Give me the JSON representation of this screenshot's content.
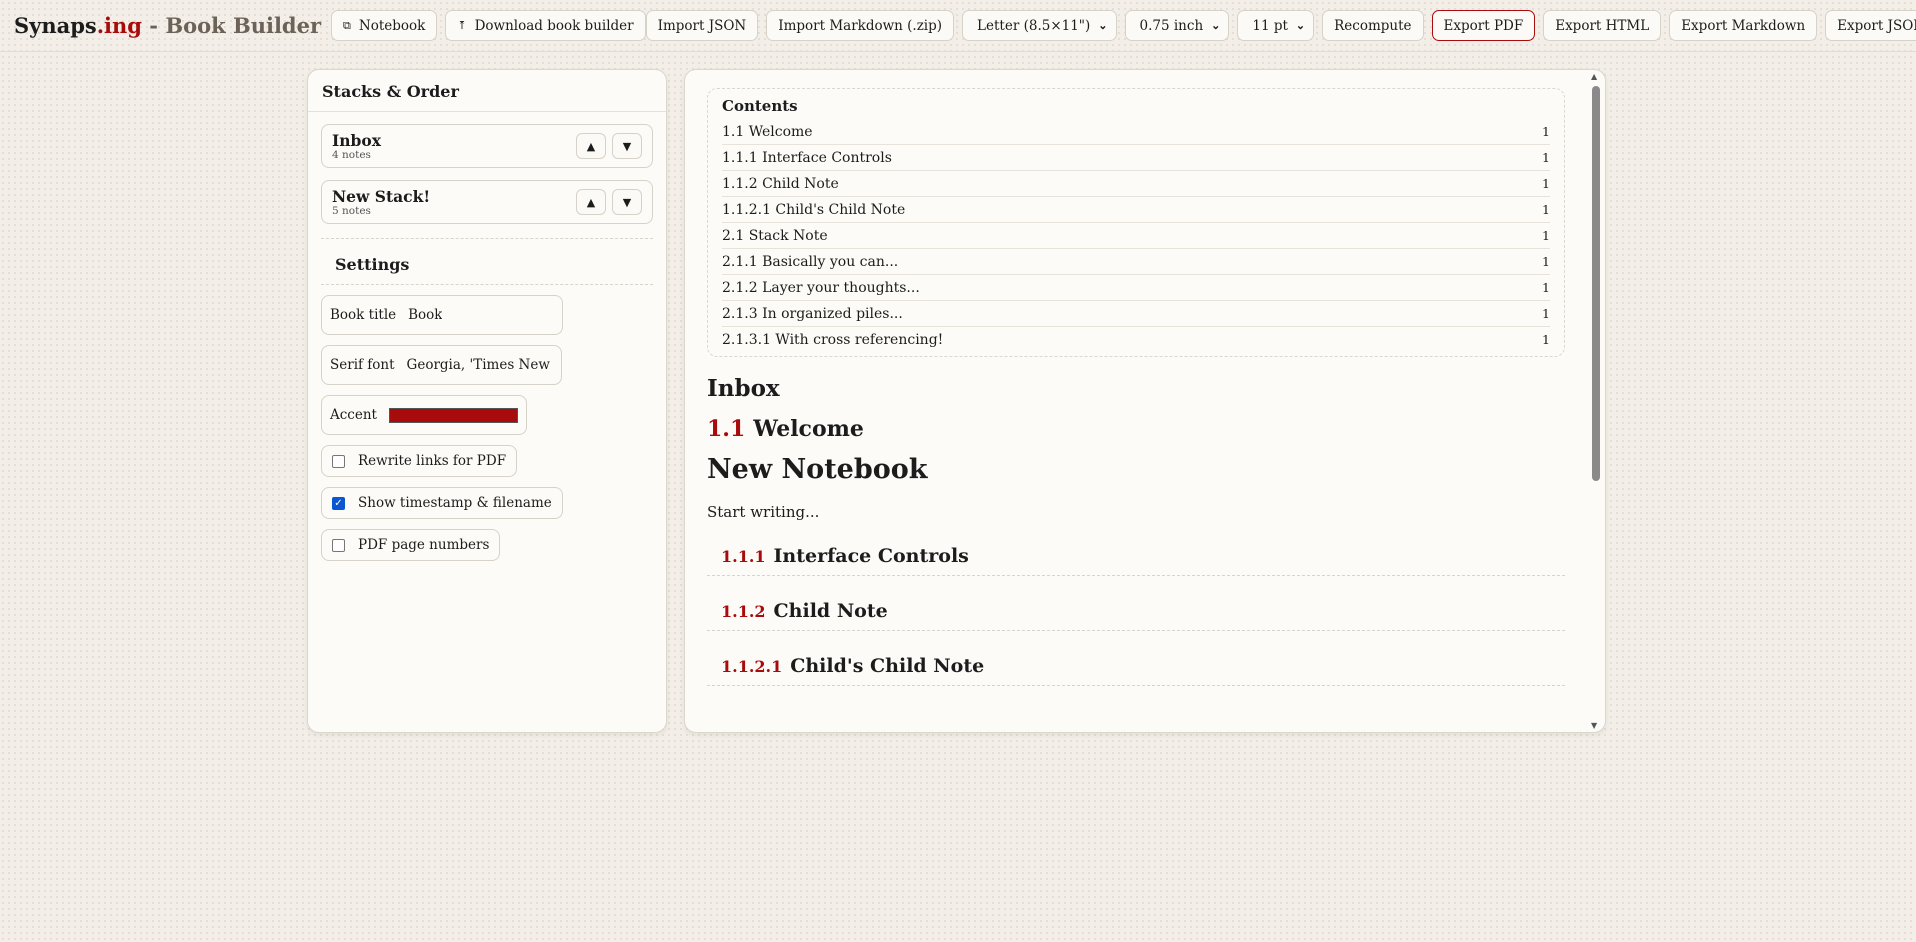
{
  "brand": {
    "name": "Synaps",
    "accent": ".ing",
    "rest": " - Book Builder"
  },
  "topbar": {
    "notebook": "Notebook",
    "download": "Download book builder",
    "import_json": "Import JSON",
    "import_md": "Import Markdown (.zip)",
    "paper": "Letter (8.5×11\")",
    "margin": "0.75 inch",
    "font_size": "11 pt",
    "recompute": "Recompute",
    "export_pdf": "Export PDF",
    "export_html": "Export HTML",
    "export_md": "Export Markdown",
    "export_json": "Export JSON"
  },
  "left": {
    "title": "Stacks & Order",
    "stacks": [
      {
        "name": "Inbox",
        "count": "4 notes"
      },
      {
        "name": "New Stack!",
        "count": "5 notes"
      }
    ],
    "settings_title": "Settings",
    "book_title_label": "Book title",
    "book_title_value": "Book",
    "serif_label": "Serif font",
    "serif_value": "Georgia, 'Times New Ron",
    "accent_label": "Accent",
    "accent_color": "#a80b0b",
    "checks": [
      {
        "label": "Rewrite links for PDF",
        "checked": false
      },
      {
        "label": "Show timestamp & filename",
        "checked": true
      },
      {
        "label": "PDF page numbers",
        "checked": false
      }
    ]
  },
  "preview": {
    "toc_title": "Contents",
    "toc": [
      {
        "text": "1.1 Welcome",
        "page": "1"
      },
      {
        "text": "1.1.1 Interface Controls",
        "page": "1"
      },
      {
        "text": "1.1.2 Child Note",
        "page": "1"
      },
      {
        "text": "1.1.2.1 Child's Child Note",
        "page": "1"
      },
      {
        "text": "2.1 Stack Note",
        "page": "1"
      },
      {
        "text": "2.1.1 Basically you can...",
        "page": "1"
      },
      {
        "text": "2.1.2 Layer your thoughts...",
        "page": "1"
      },
      {
        "text": "2.1.3 In organized piles...",
        "page": "1"
      },
      {
        "text": "2.1.3.1 With cross referencing!",
        "page": "1"
      }
    ],
    "stack_heading": "Inbox",
    "welcome_num": "1.1",
    "welcome_title": "Welcome",
    "notebook_heading": "New Notebook",
    "paragraph": "Start writing...",
    "subs": [
      {
        "num": "1.1.1",
        "title": "Interface Controls"
      },
      {
        "num": "1.1.2",
        "title": "Child Note"
      },
      {
        "num": "1.1.2.1",
        "title": "Child's Child Note"
      }
    ]
  }
}
